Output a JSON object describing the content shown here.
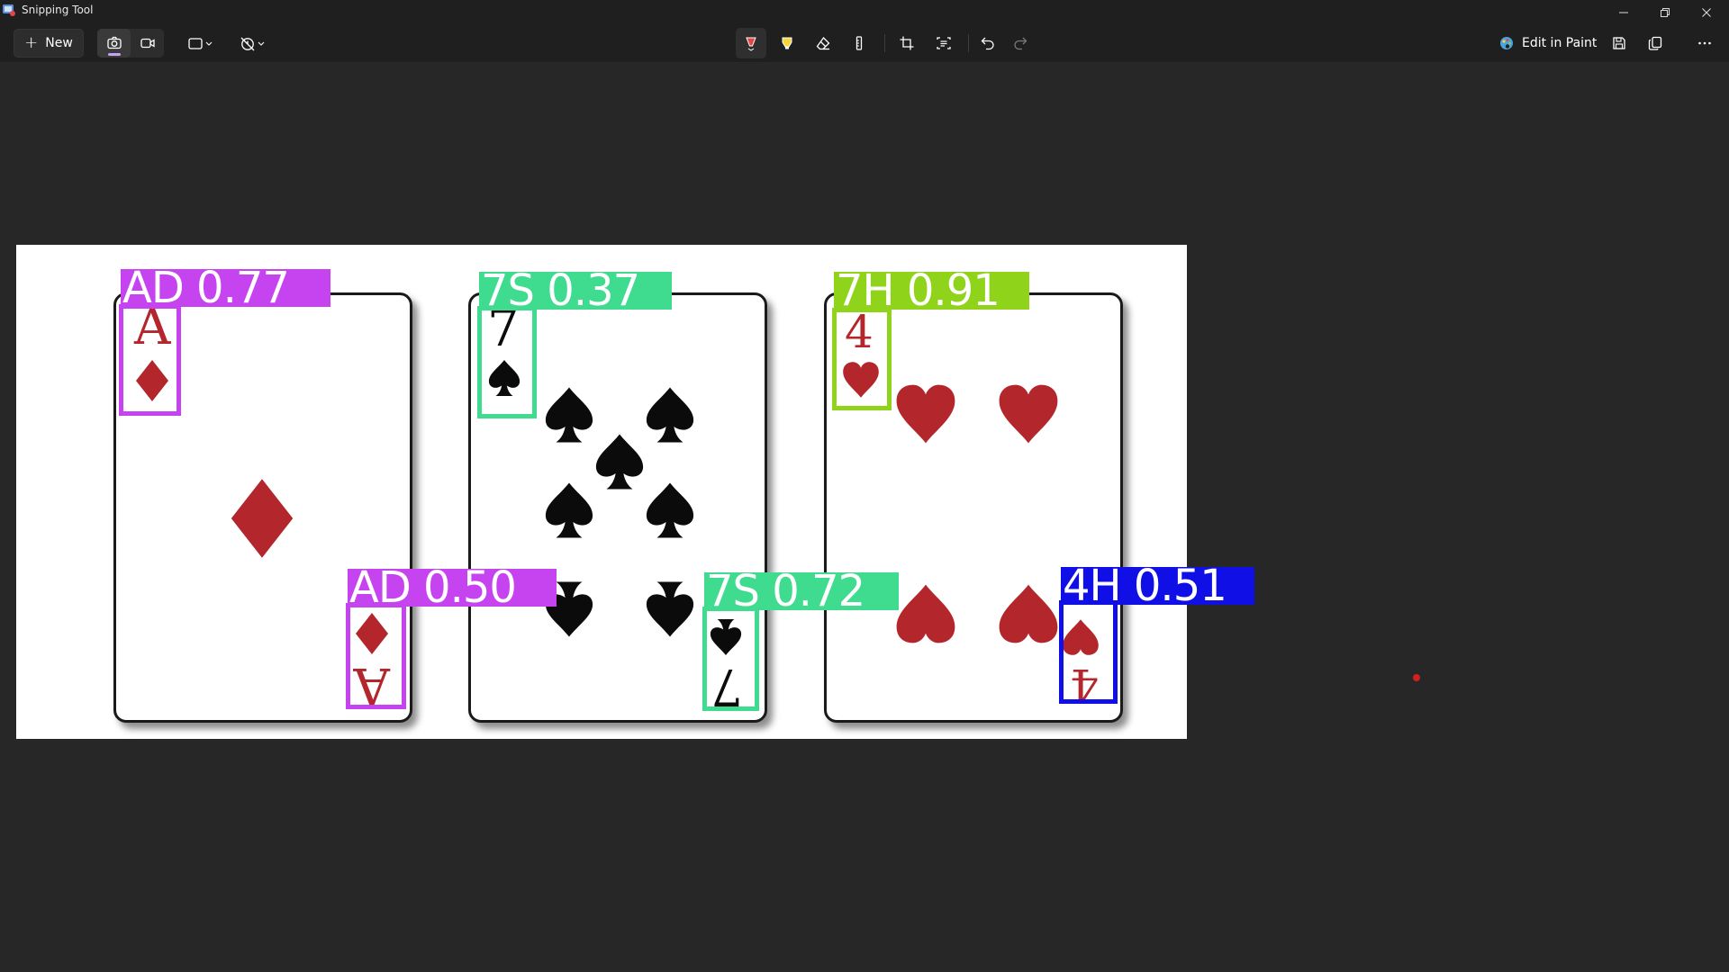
{
  "window": {
    "title": "Snipping Tool",
    "controls": [
      "minimize",
      "restore",
      "close"
    ]
  },
  "toolbar": {
    "new_label": "New",
    "edit_in_paint_label": "Edit in Paint",
    "icons": {
      "capture_modes": [
        "camera-icon",
        "video-icon"
      ],
      "shape_dropdown": "rectangle-mode-icon",
      "delay_dropdown": "no-delay-icon",
      "annotate": [
        "ballpoint-pen-icon",
        "highlighter-icon",
        "eraser-icon",
        "ruler-icon"
      ],
      "edit": [
        "crop-icon",
        "text-actions-icon",
        "undo-icon",
        "redo-icon"
      ],
      "file": [
        "save-icon",
        "copy-icon",
        "more-icon"
      ]
    },
    "colors": {
      "pen": "#e64545",
      "highlighter": "#f5d63d",
      "paint": "#4aa3df",
      "active_underline": "#c6a3f0"
    }
  },
  "detections": [
    {
      "label": "AD 0.77",
      "color": "#c643f0"
    },
    {
      "label": "AD 0.50",
      "color": "#c643f0"
    },
    {
      "label": "7S 0.37",
      "color": "#3fdb8e"
    },
    {
      "label": "7S 0.72",
      "color": "#3fdb8e"
    },
    {
      "label": "7H 0.91",
      "color": "#8fd41b"
    },
    {
      "label": "4H 0.51",
      "color": "#1010e6"
    }
  ],
  "cards": [
    {
      "rank": "A",
      "suit": "diamond"
    },
    {
      "rank": "7",
      "suit": "spade"
    },
    {
      "rank": "4",
      "suit": "heart"
    }
  ]
}
